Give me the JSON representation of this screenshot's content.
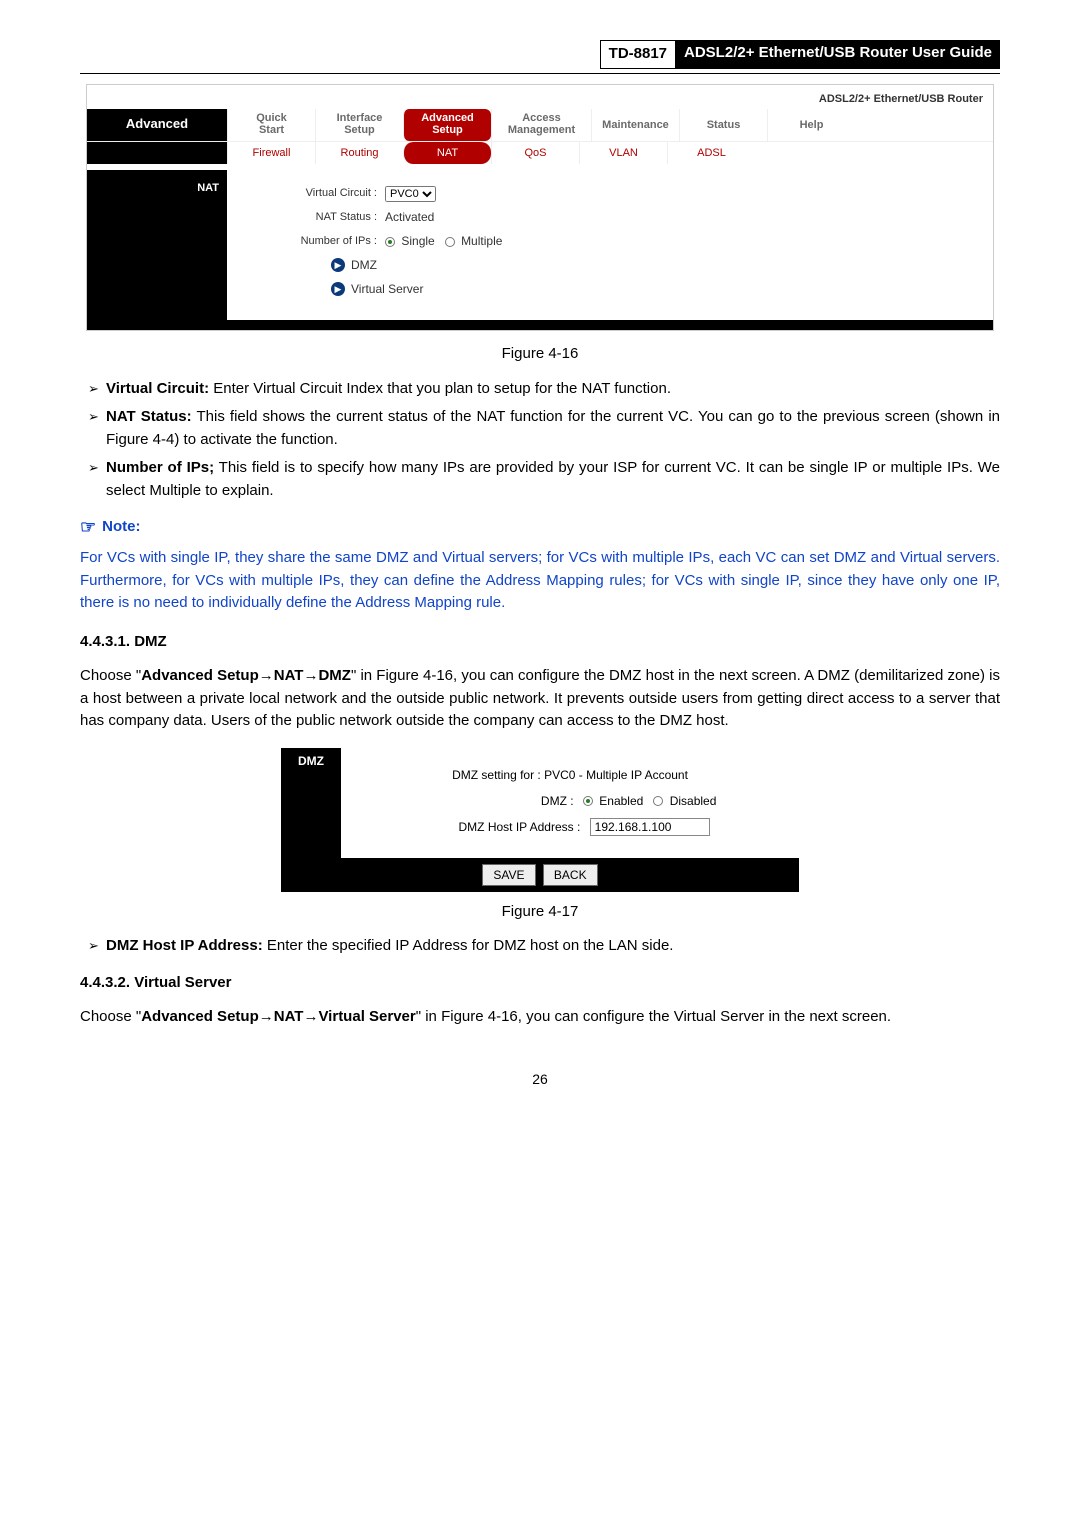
{
  "header": {
    "model": "TD-8817",
    "title": "ADSL2/2+ Ethernet/USB Router User Guide"
  },
  "router1": {
    "brand": "ADSL2/2+ Ethernet/USB Router",
    "side_label": "Advanced",
    "tabs1": {
      "quick": {
        "l1": "Quick",
        "l2": "Start"
      },
      "interface": {
        "l1": "Interface",
        "l2": "Setup"
      },
      "advanced": {
        "l1": "Advanced",
        "l2": "Setup"
      },
      "access": {
        "l1": "Access",
        "l2": "Management"
      },
      "maintenance": "Maintenance",
      "status": "Status",
      "help": "Help"
    },
    "tabs2": {
      "firewall": "Firewall",
      "routing": "Routing",
      "nat": "NAT",
      "qos": "QoS",
      "vlan": "VLAN",
      "adsl": "ADSL"
    },
    "nat_side": "NAT",
    "rows": {
      "vc_label": "Virtual Circuit :",
      "vc_value": "PVC0",
      "status_label": "NAT Status :",
      "status_value": "Activated",
      "ips_label": "Number of IPs :",
      "ips_single": "Single",
      "ips_multiple": "Multiple",
      "dmz": "DMZ",
      "vserver": "Virtual Server"
    }
  },
  "fig1": "Figure 4-16",
  "bullets1": {
    "b1_label": "Virtual Circuit:",
    "b1_text": " Enter Virtual Circuit Index that you plan to setup for the NAT function.",
    "b2_label": "NAT Status:",
    "b2_text": " This field shows the current status of the NAT function for the current VC. You can go to the previous screen (shown in Figure 4-4) to activate the function.",
    "b3_label": "Number of IPs;",
    "b3_text": " This field is to specify how many IPs are provided by your ISP for current VC. It can be single IP or multiple IPs. We select Multiple to explain."
  },
  "note": {
    "head": "Note:",
    "body": "For VCs with single IP, they share the same DMZ and Virtual servers; for VCs with multiple IPs, each VC can set DMZ and Virtual servers. Furthermore, for VCs with multiple IPs, they can define the Address Mapping rules; for VCs with single IP, since they have only one IP, there is no need to individually define the Address Mapping rule."
  },
  "sec_dmz": {
    "num": "4.4.3.1.  DMZ",
    "para_pre": "Choose \"",
    "bold1": "Advanced Setup",
    "arrow": "→",
    "bold2": "NAT",
    "bold3": "DMZ",
    "para_post": "\" in Figure 4-16, you can configure the DMZ host in the next screen. A DMZ (demilitarized zone) is a host between a private local network and the outside public network. It prevents outside users from getting direct access to a server that has company data. Users of the public network outside the company can access to the DMZ host."
  },
  "dmz_shot": {
    "side": "DMZ",
    "setting": "DMZ setting for : PVC0 - Multiple IP Account",
    "dmz_label": "DMZ :",
    "enabled": "Enabled",
    "disabled": "Disabled",
    "ip_label": "DMZ Host IP Address :",
    "ip_value": "192.168.1.100",
    "save": "SAVE",
    "back": "BACK"
  },
  "fig2": "Figure 4-17",
  "bullets2": {
    "b1_label": "DMZ Host IP Address:",
    "b1_text": " Enter the specified IP Address for DMZ host on the LAN side."
  },
  "sec_vs": {
    "num": "4.4.3.2.  Virtual Server",
    "para_pre": "Choose \"",
    "bold1": "Advanced Setup",
    "arrow": "→",
    "bold2": "NAT",
    "bold3": "Virtual Server",
    "para_post": "\" in Figure 4-16, you can configure the Virtual Server in the next screen."
  },
  "page_num": "26"
}
